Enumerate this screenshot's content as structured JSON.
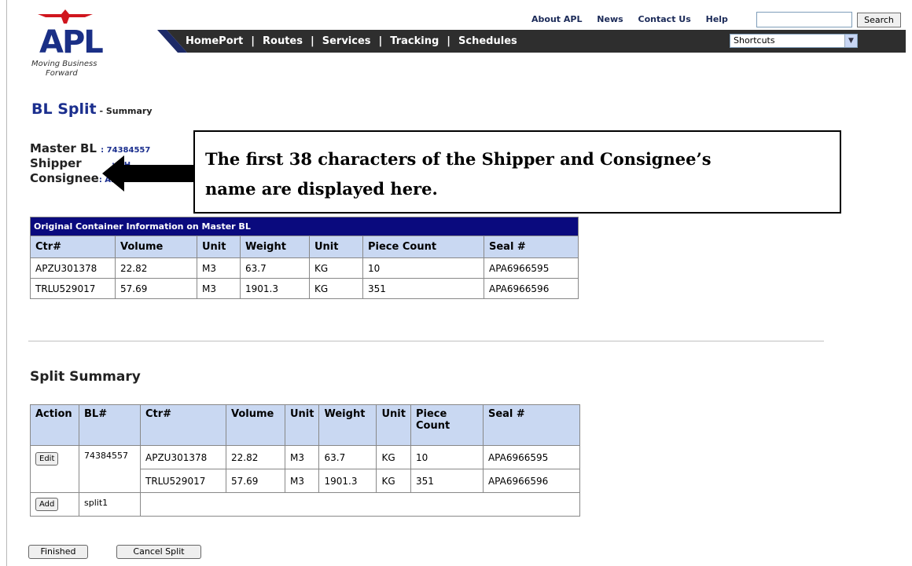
{
  "logo": {
    "text": "APL",
    "tagline1": "Moving Business",
    "tagline2": "Forward"
  },
  "top_links": [
    "About APL",
    "News",
    "Contact Us",
    "Help"
  ],
  "search": {
    "button": "Search",
    "value": ""
  },
  "nav": [
    "HomePort",
    "Routes",
    "Services",
    "Tracking",
    "Schedules"
  ],
  "shortcuts": {
    "selected": "Shortcuts"
  },
  "page": {
    "title": "BL Split",
    "subtitle": " - Summary"
  },
  "master": {
    "bl_label": "Master BL",
    "bl_value": ": 74384557",
    "shipper_label": "Shipper",
    "shipper_value": ": DH",
    "consignee_label": "Consignee",
    "consignee_value": ": ALIN A ROUT"
  },
  "callout": {
    "line1": "The first 38 characters of the Shipper and  Consignee’s",
    "line2": "name are displayed here."
  },
  "original": {
    "banner": "Original Container Information on Master BL",
    "headers": [
      "Ctr#",
      "Volume",
      "Unit",
      "Weight",
      "Unit",
      "Piece Count",
      "Seal #"
    ],
    "rows": [
      [
        "APZU301378",
        "22.82",
        "M3",
        "63.7",
        "KG",
        "10",
        "APA6966595"
      ],
      [
        "TRLU529017",
        "57.69",
        "M3",
        "1901.3",
        "KG",
        "351",
        "APA6966596"
      ]
    ]
  },
  "split": {
    "title": "Split  Summary",
    "headers": [
      "Action",
      "BL#",
      "Ctr#",
      "Volume",
      "Unit",
      "Weight",
      "Unit",
      "Piece Count",
      "Seal #"
    ],
    "rows": [
      [
        "APZU301378",
        "22.82",
        "M3",
        "63.7",
        "KG",
        "10",
        "APA6966595"
      ],
      [
        "TRLU529017",
        "57.69",
        "M3",
        "1901.3",
        "KG",
        "351",
        "APA6966596"
      ]
    ],
    "edit": "Edit",
    "bl": "74384557",
    "add": "Add",
    "new_bl": "split1"
  },
  "buttons": {
    "finished": "Finished",
    "cancel": "Cancel Split"
  },
  "colors": {
    "brand": "#1b2f8e",
    "banner": "#0a0a7e",
    "header_bg": "#c9d8f2",
    "nav_bg": "#2e2e2e"
  }
}
